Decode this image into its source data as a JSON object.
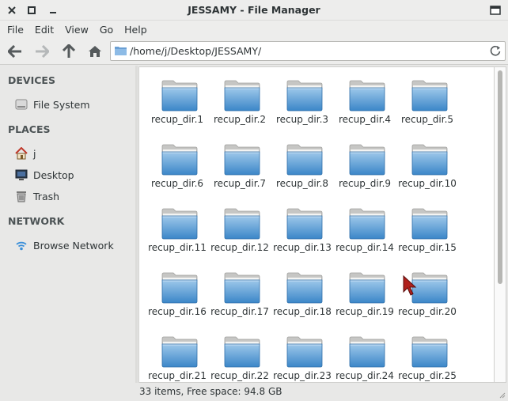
{
  "window": {
    "title": "JESSAMY - File Manager"
  },
  "menubar": {
    "items": [
      "File",
      "Edit",
      "View",
      "Go",
      "Help"
    ]
  },
  "address": {
    "path": "/home/j/Desktop/JESSAMY/"
  },
  "sidebar": {
    "devices_header": "DEVICES",
    "places_header": "PLACES",
    "network_header": "NETWORK",
    "devices": [
      {
        "label": "File System",
        "icon": "drive-icon"
      }
    ],
    "places": [
      {
        "label": "j",
        "icon": "home-icon"
      },
      {
        "label": "Desktop",
        "icon": "desktop-icon"
      },
      {
        "label": "Trash",
        "icon": "trash-icon"
      }
    ],
    "network": [
      {
        "label": "Browse Network",
        "icon": "network-icon"
      }
    ]
  },
  "folders": [
    "recup_dir.1",
    "recup_dir.2",
    "recup_dir.3",
    "recup_dir.4",
    "recup_dir.5",
    "recup_dir.6",
    "recup_dir.7",
    "recup_dir.8",
    "recup_dir.9",
    "recup_dir.10",
    "recup_dir.11",
    "recup_dir.12",
    "recup_dir.13",
    "recup_dir.14",
    "recup_dir.15",
    "recup_dir.16",
    "recup_dir.17",
    "recup_dir.18",
    "recup_dir.19",
    "recup_dir.20",
    "recup_dir.21",
    "recup_dir.22",
    "recup_dir.23",
    "recup_dir.24",
    "recup_dir.25"
  ],
  "status": {
    "text": "33 items, Free space: 94.8 GB"
  },
  "colors": {
    "folder_top": "#9ec8ea",
    "folder_bottom": "#3b86c8",
    "accent": "#4a90d9"
  }
}
